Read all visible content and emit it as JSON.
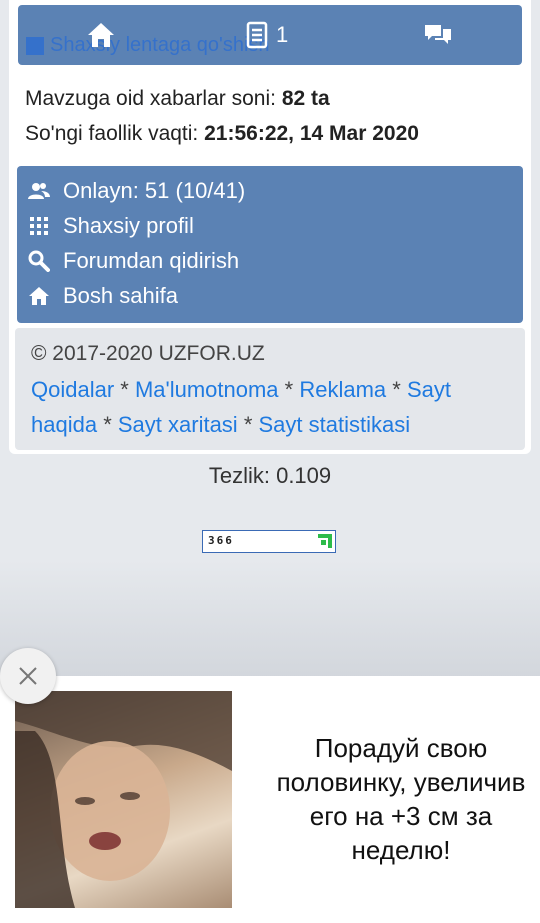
{
  "topbar": {
    "faded_link": "Shaxsiy lentaga qo'shish",
    "files_count": "1"
  },
  "info": {
    "posts_label": "Mavzuga oid xabarlar soni: ",
    "posts_value": "82 ta",
    "activity_label": "So'ngi faollik vaqti: ",
    "activity_value": "21:56:22, 14 Mar 2020"
  },
  "menu": {
    "items": [
      {
        "label": "Onlayn: 51 (10/41)",
        "icon": "users-icon"
      },
      {
        "label": "Shaxsiy profil",
        "icon": "grid-icon"
      },
      {
        "label": "Forumdan qidirish",
        "icon": "search-icon"
      },
      {
        "label": "Bosh sahifa",
        "icon": "home-icon"
      }
    ]
  },
  "footer": {
    "copyright": "© 2017-2020 UZFOR.UZ",
    "links": [
      "Qoidalar",
      "Ma'lumotnoma",
      "Reklama",
      "Sayt haqida",
      "Sayt xaritasi",
      "Sayt statistikasi"
    ],
    "separator": " * "
  },
  "speed": "Tezlik: 0.109",
  "counter": "366",
  "ad": {
    "text": "Порадуй свою половинку, увеличив его на +3 см за неделю!"
  },
  "colors": {
    "bar": "#5b82b4",
    "link": "#1f7ae0"
  }
}
